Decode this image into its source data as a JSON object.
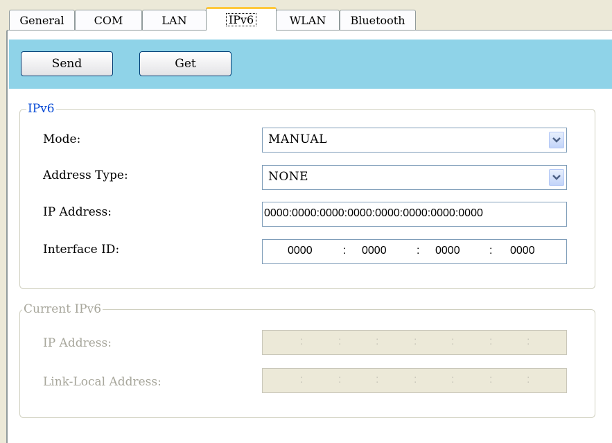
{
  "tabs": [
    {
      "label": "General"
    },
    {
      "label": "COM"
    },
    {
      "label": "LAN"
    },
    {
      "label": "IPv6",
      "active": true
    },
    {
      "label": "WLAN"
    },
    {
      "label": "Bluetooth"
    }
  ],
  "toolbar": {
    "send_label": "Send",
    "get_label": "Get"
  },
  "ipv6": {
    "group_title": "IPv6",
    "mode_label": "Mode:",
    "mode_value": "MANUAL",
    "address_type_label": "Address Type:",
    "address_type_value": "NONE",
    "ip_address_label": "IP Address:",
    "ip_address_value": "0000:0000:0000:0000:0000:0000:0000:0000",
    "interface_id_label": "Interface ID:",
    "interface_id": [
      "0000",
      "0000",
      "0000",
      "0000"
    ],
    "separator": ":"
  },
  "current_ipv6": {
    "group_title": "Current IPv6",
    "ip_address_label": "IP Address:",
    "link_local_label": "Link-Local Address:",
    "separator": ":"
  },
  "icons": {
    "dropdown": "chevron-down-icon"
  },
  "colors": {
    "toolbar_bg": "#8fd3e8",
    "active_tab_accent": "#ffc83c",
    "group_title_active": "#0046d5",
    "disabled_text": "#a7a69b",
    "disabled_field_bg": "#ece9d8"
  }
}
